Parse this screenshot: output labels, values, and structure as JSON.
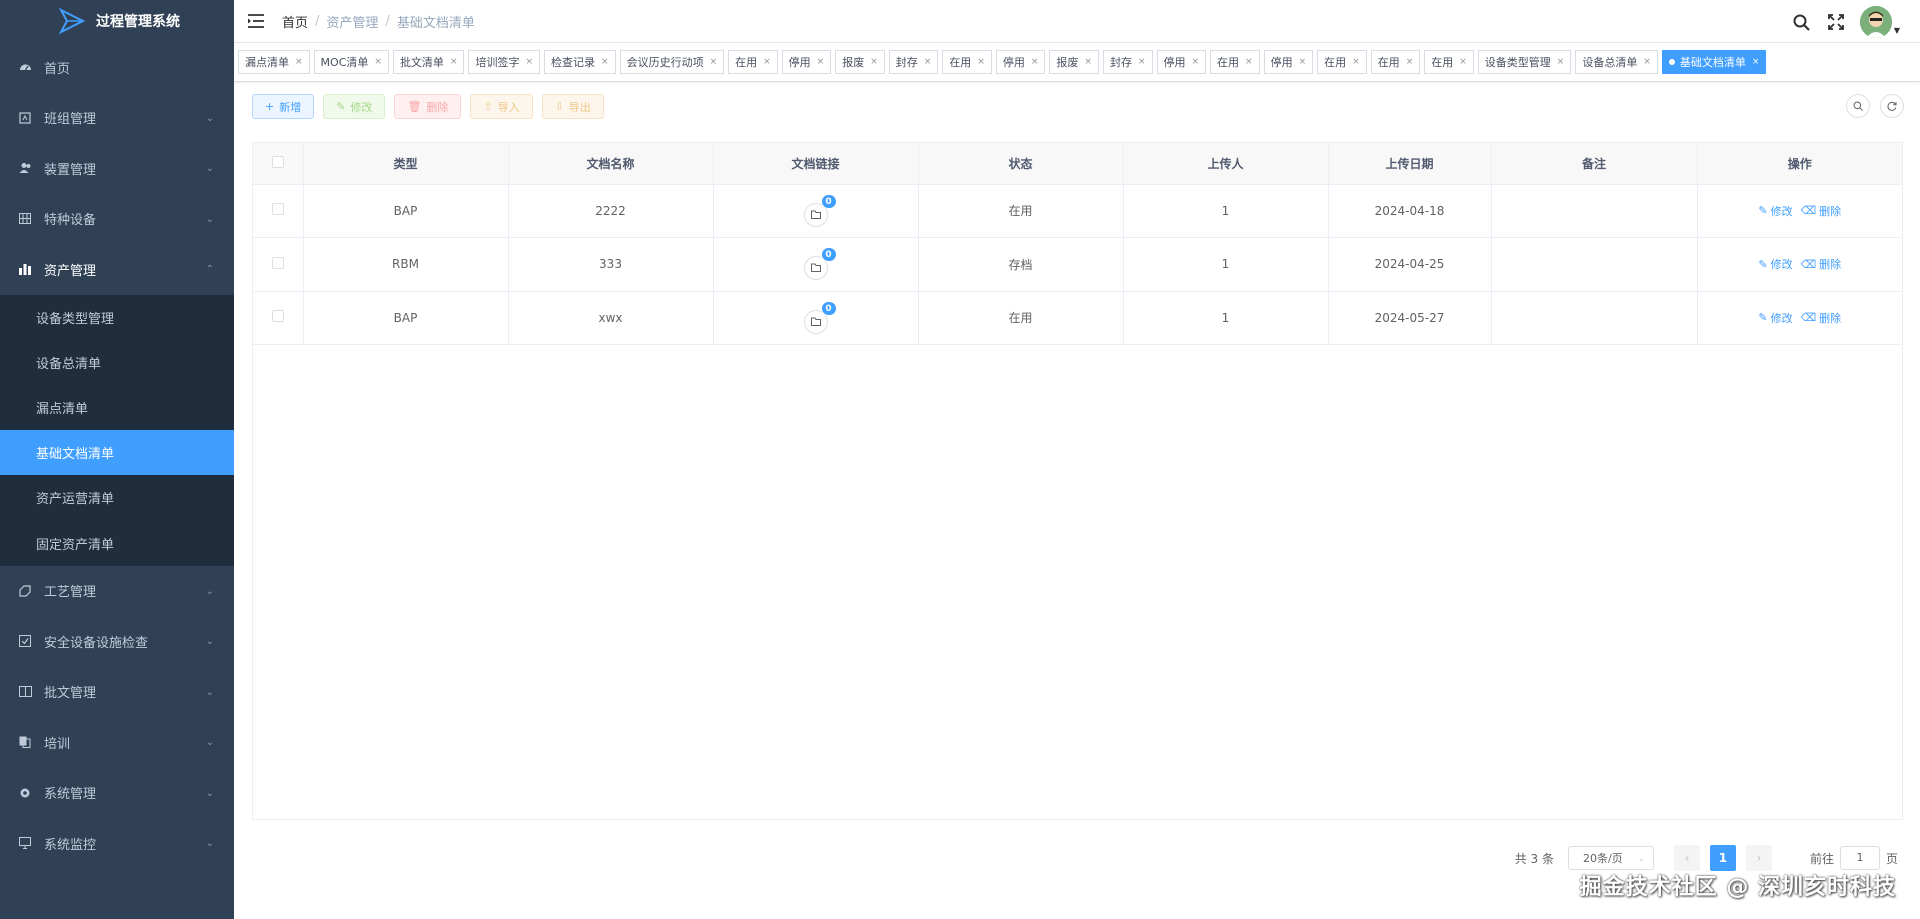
{
  "app": {
    "title": "过程管理系统"
  },
  "sidebar": {
    "items": [
      {
        "label": "首页",
        "icon": "dashboard-icon"
      },
      {
        "label": "班组管理",
        "icon": "team-icon"
      },
      {
        "label": "装置管理",
        "icon": "user-group-icon"
      },
      {
        "label": "特种设备",
        "icon": "grid-icon"
      },
      {
        "label": "资产管理",
        "icon": "bar-chart-icon"
      }
    ],
    "asset_sub": [
      {
        "label": "设备类型管理"
      },
      {
        "label": "设备总清单"
      },
      {
        "label": "漏点清单"
      },
      {
        "label": "基础文档清单",
        "active": true
      },
      {
        "label": "资产运营清单"
      },
      {
        "label": "固定资产清单"
      }
    ],
    "items_bottom": [
      {
        "label": "工艺管理",
        "icon": "process-icon"
      },
      {
        "label": "安全设备设施检查",
        "icon": "checkbox-icon"
      },
      {
        "label": "批文管理",
        "icon": "book-icon"
      },
      {
        "label": "培训",
        "icon": "copy-icon"
      },
      {
        "label": "系统管理",
        "icon": "gear-icon"
      },
      {
        "label": "系统监控",
        "icon": "monitor-icon"
      }
    ]
  },
  "breadcrumb": {
    "home": "首页",
    "mid": "资产管理",
    "current": "基础文档清单"
  },
  "tags": [
    "漏点清单",
    "MOC清单",
    "批文清单",
    "培训签字",
    "检查记录",
    "会议历史行动项",
    "在用",
    "停用",
    "报废",
    "封存",
    "在用",
    "停用",
    "报废",
    "封存",
    "停用",
    "在用",
    "停用",
    "在用",
    "在用",
    "在用",
    "设备类型管理",
    "设备总清单",
    "基础文档清单"
  ],
  "toolbar": {
    "add": "新增",
    "edit": "修改",
    "delete": "删除",
    "import": "导入",
    "export": "导出"
  },
  "table": {
    "headers": [
      "类型",
      "文档名称",
      "文档链接",
      "状态",
      "上传人",
      "上传日期",
      "备注",
      "操作"
    ],
    "rows": [
      {
        "type": "BAP",
        "name": "2222",
        "links": "0",
        "status": "在用",
        "uploader": "1",
        "date": "2024-04-18",
        "remark": ""
      },
      {
        "type": "RBM",
        "name": "333",
        "links": "0",
        "status": "存档",
        "uploader": "1",
        "date": "2024-04-25",
        "remark": ""
      },
      {
        "type": "BAP",
        "name": "xwx",
        "links": "0",
        "status": "在用",
        "uploader": "1",
        "date": "2024-05-27",
        "remark": ""
      }
    ],
    "op_edit": "修改",
    "op_delete": "删除"
  },
  "pagination": {
    "total": "共 3 条",
    "page_size": "20条/页",
    "current": "1",
    "goto_label": "前往",
    "goto_value": "1",
    "page_suffix": "页"
  },
  "watermark": "掘金技术社区 @ 深圳亥时科技",
  "colors": {
    "sidebar": "#304156",
    "submenu": "#1f2d3d",
    "accent": "#409eff"
  }
}
